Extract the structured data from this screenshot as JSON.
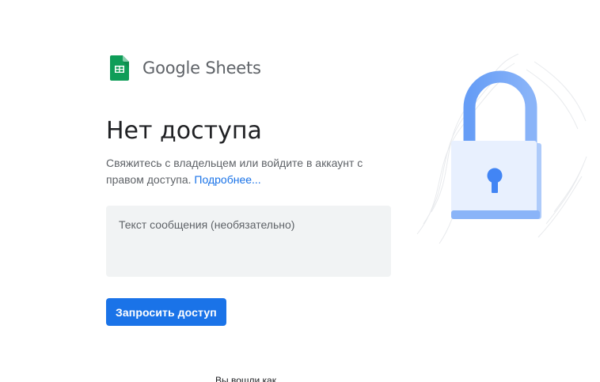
{
  "brand": {
    "name": "Google Sheets",
    "logo_icon": "google-sheets-icon",
    "color": "#0f9d58"
  },
  "main": {
    "title": "Нет доступа",
    "description": "Свяжитесь с владельцем или войдите в аккаунт с правом доступа.",
    "more_link": "Подробнее..."
  },
  "form": {
    "message_placeholder": "Текст сообщения (необязательно)",
    "message_value": "",
    "request_button": "Запросить доступ"
  },
  "footer": {
    "signed_in_as": "Вы вошли как"
  },
  "illustration": {
    "icon": "padlock-icon"
  },
  "colors": {
    "accent": "#1a73e8",
    "input_bg": "#f1f3f4",
    "title": "#202124",
    "secondary_text": "#5f6368"
  }
}
